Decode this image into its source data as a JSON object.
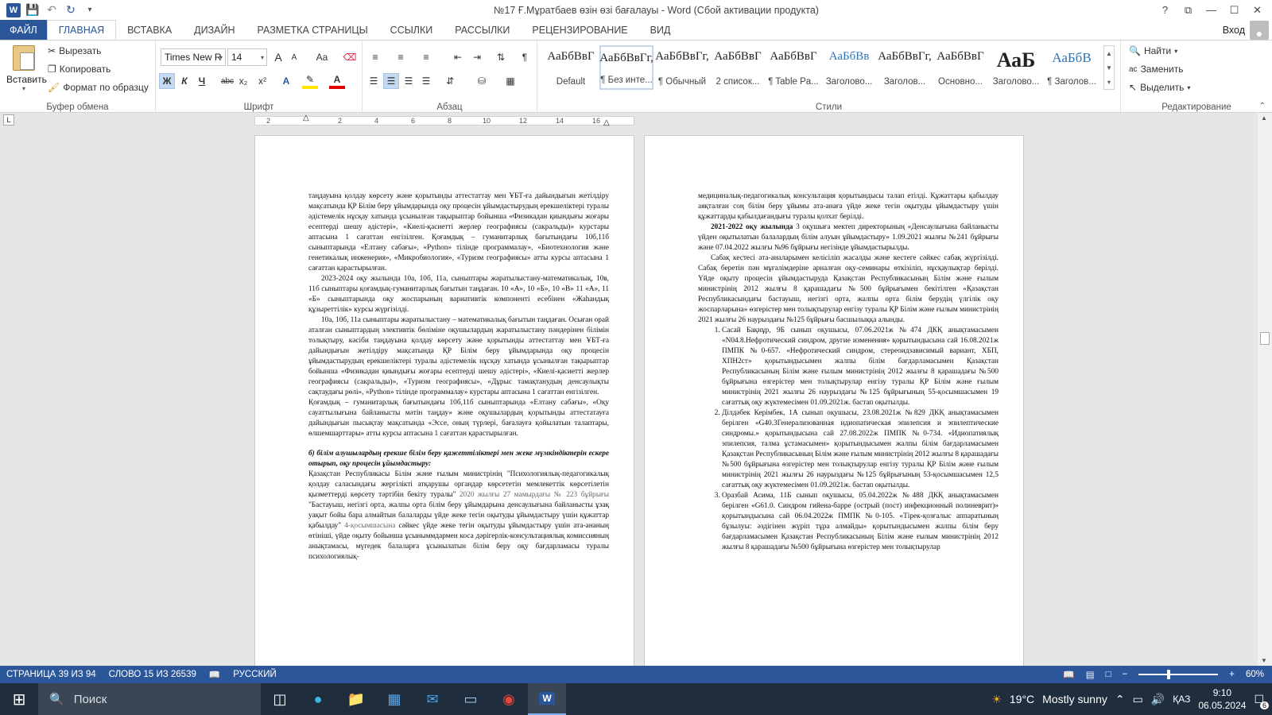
{
  "title": "№17 Ғ.Мұратбаев өзін өзі бағалауы - Word (Сбой активации продукта)",
  "window_controls": {
    "help": "?",
    "restore_ribbon": "⧉",
    "minimize": "—",
    "maximize": "☐",
    "close": "✕"
  },
  "tabs": [
    "ФАЙЛ",
    "ГЛАВНАЯ",
    "ВСТАВКА",
    "ДИЗАЙН",
    "РАЗМЕТКА СТРАНИЦЫ",
    "ССЫЛКИ",
    "РАССЫЛКИ",
    "РЕЦЕНЗИРОВАНИЕ",
    "ВИД"
  ],
  "signin": "Вход",
  "clipboard": {
    "paste": "Вставить",
    "cut": "Вырезать",
    "copy": "Копировать",
    "format_painter": "Формат по образцу",
    "group": "Буфер обмена"
  },
  "font": {
    "name": "Times New R",
    "size": "14",
    "group": "Шрифт",
    "bold": "Ж",
    "italic": "К",
    "underline": "Ч",
    "strike": "abc",
    "sub": "x₂",
    "sup": "x²",
    "grow": "A",
    "shrink": "A",
    "case": "Aa"
  },
  "paragraph": {
    "group": "Абзац"
  },
  "styles": {
    "group": "Стили",
    "items": [
      {
        "preview": "АаБбВвГ",
        "name": "Default"
      },
      {
        "preview": "АаБбВвГг,",
        "name": "¶ Без инте..."
      },
      {
        "preview": "АаБбВвГг,",
        "name": "¶ Обычный"
      },
      {
        "preview": "АаБбВвГ",
        "name": "2 список..."
      },
      {
        "preview": "АаБбВвГ",
        "name": "¶ Table Pa..."
      },
      {
        "preview": "АаБбВв",
        "name": "Заголово..."
      },
      {
        "preview": "АаБбВвГг,",
        "name": "Заголов..."
      },
      {
        "preview": "АаБбВвГ",
        "name": "Основно..."
      },
      {
        "preview": "АаБ",
        "name": "Заголово..."
      },
      {
        "preview": "АаБбВ",
        "name": "¶ Заголов..."
      }
    ]
  },
  "editing": {
    "find": "Найти",
    "replace": "Заменить",
    "select": "Выделить",
    "group": "Редактирование"
  },
  "ruler_labels": [
    "2",
    "2",
    "4",
    "6",
    "8",
    "10",
    "12",
    "14",
    "16"
  ],
  "page_left": {
    "p1": "таңдауына қолдау көрсету және қорытынды аттестаттау мен ҰБТ-ға дайындығын жетілдіру мақсатында ҚР Білім беру ұйымдарында оқу процесін ұйымдастырудың ерекшеліктері туралы әдістемелік нұсқау хатында ұсынылған тақырыптар бойынша «Физикадан қиындығы жоғары есептерді шешу әдістері», «Киелі-қасиетті жерлер географиясы (сакральды)» курстары аптасына 1 сағаттан енгізілген. Қоғамдық – гуманитарлық бағытындағы 10б,11б сыныптарында «Елтану сабағы», «Python» тілінде программалау», «Биотехнология және генетикалық инженерия», «Микробиология», «Туризм географиясы» атты курсы аптасына 1 сағаттан қарастырылған.",
    "p2": "2023-2024 оқу жылында 10а, 10б, 11а, сыныптары жаратылыстану-математикалық, 10в, 11б сыныптары қоғамдық-гуманитарлық бағытын таңдаған. 10 «А», 10 «Б», 10 «В» 11 «А», 11 «Б» сыныптарында оқу жоспарының вариативтік компоненті есебінен «Жаһандық құзыреттілік» курсы жүргізілді.",
    "p3": "10а, 10б, 11а сыныптары жаратылыстану – математикалық бағытын таңдаған. Осыған орай аталған сыныптардың элективтік бөліміне оқушылардың жаратылыстану пәндерінен білімін толықтыру, кәсіби таңдауына қолдау көрсету және қорытынды аттестаттау мен ҰБТ-ға дайындығын жетілдіру мақсатында ҚР Білім беру ұйымдарында оқу процесін ұйымдастырудың ерекшеліктері туралы әдістемелік нұсқау хатында ұсынылған тақырыптар бойынша «Физикадан қиындығы жоғары есептерді шешу әдістері», «Киелі-қасиетті жерлер географиясы (сакральды)», «Туризм географиясы», «Дұрыс тамақтанудың денсаулықты сақтаудағы рөлі», «Python» тілінде программалау» курстары аптасына 1 сағаттан енгізілген.",
    "p4": "Қоғамдық – гуманитарлық бағытындағы 10б,11б сыныптарында «Елтану сабағы», «Оқу сауаттылығына байланысты мәтін таңдау» және оқушылардың қорытынды аттестатауға дайындығын пысықтау мақсатында «Эссе, оның түрлері, бағалауға қойылатын талаптары, өлшемшарттары» атты курсы аптасына 1 сағаттан қарастырылған.",
    "heading": "б) білім алушылардың ерекше білім беру қажеттіліктері мен жеке мүмкіндіктерін ескере отырып, оқу процесін ұйымдастыру:",
    "p5a": "Қазақстан Республикасы Білім және ғылым министрінің \"Психологиялық-педагогикалық қолдау саласындағы жергілікті атқарушы органдар көрсететін мемлекеттік көрсетілетін қызметтерді көрсету тәртібін бекіту туралы\"",
    "p5b": " 2020 жылғы 27 мамырдағы № 223 бұйрығы ",
    "p5c": "\"Бастауыш, негізгі орта, жалпы орта білім беру ұйымдарына денсаулығына байланысты ұзақ уақыт бойы бара алмайтын балаларды үйде жеке тегін оқытуды ұйымдастыру үшін құжаттар қабылдау\"",
    "p5d": " 4-қосымшасына ",
    "p5e": "сәйкес үйде жеке тегін оқытуды ұйымдастыру үшін ата-ананың өтініші, үйде оқыту бойынша ұсыныммдармен коса дәрігерлік-консультациялық комиссияның анықтамасы, мүгедек балаларға ұсынылатын білім беру оқу бағдарламасы туралы психологиялық-"
  },
  "page_right": {
    "p1": "медициналық-педагогикалық консультация қорытындысы талап етілді. Құжаттары қабылдау аяқталған соң білім беру ұйымы ата-анаға үйде жеке тегін оқытуды ұйымдастыру үшін құжаттарды қабылдағандығы туралы қолхат берілді.",
    "p2a": "2021-2022 оқу жылында",
    "p2b": " 3 оқушыға мектеп директорының «Денсаулығына байланысты үйден оқытылатын балалардың білім алуын ұйымдастыру» 1.09.2021 жылғы №241 бұйрығы және 07.04.2022 жылғы №96 бұйрығы негізінде ұйымдастырылды.",
    "p3": "Сабақ кестесі ата-аналарымен келісіліп жасалды және кестеге сәйкес сабақ жүргізілді. Сабақ беретін пән мұғалімдеріне арналған оқу-семинары өткізіліп, нұсқаулықтар берілді. Үйде оқыту процесін ұйымдастыруда Қазақстан Республикасының Білім және ғылым министрінің 2012 жылғы 8 қарашадағы №500 бұйрығымен бекітілген «Қазақстан Республикасындағы бастауыш, негізгі орта, жалпы орта білім берудің үлгілік оқу жоспарларына» өзгерістер мен толықтырулар енгізу туралы ҚР Білім және ғылым министрінің 2021 жылғы 26 наурыздағы №125 бұйрығы басшылыққа алынды.",
    "li1": "Сасай Бақнұр, 9Б сынып оқушысы, 07.06.2021ж №474 ДКҚ анықтамасымен «N04.8.Нефротический синдром, другие изменения» қорытындысына сай 16.08.2021ж ПМПК №0-657. «Нефротический синдром, стереоидзависимый вариант, ХБП, ХПН2ст» қорытындысымен жалпы білім бағдарламасымен Қазақстан Республикасының Білім және ғылым министрінің 2012 жылғы 8 қарашадағы №500 бұйрығына өзгерістер мен толықтырулар енгізу туралы ҚР Білім және ғылым министрінің 2021 жылғы 26 наурыздағы №125 бұйрығының 55-қосымшасымен 19 сағаттық оқу жүктемесімен 01.09.2021ж. бастап оқытылды.",
    "li2": "Ділдәбек Керімбек, 1А сынып оқушысы, 23.08.2021ж №829 ДКҚ анықтамасымен берілген «G40.3Генерализованная идиопатическая эпилепсия и эпилептические синдромы.» қорытындысына сай 27.08.2022ж ПМПК №0-734. «Идиопатиялық эпилепсия, талма ұстамасымен» қорытындысымен жалпы білім бағдарламасымен Қазақстан Республикасының Білім және ғылым министрінің 2012 жылғы 8 қарашадағы №500 бұйрығына өзгерістер мен толықтырулар енгізу туралы ҚР Білім және ғылым министрінің 2021 жылғы 26 наурыздағы №125 бұйрығының 53-қосымшасымен 12,5 сағаттық оқу жүктемесімен 01.09.2021ж. бастап оқытылды.",
    "li3": "Оразбай Асима, 11Б сынып оқушысы, 05.04.2022ж №488 ДКҚ анықтамасымен берілген «G61.0. Синдром гийена-барре (острый (пост) инфекционный полиневрит)» қорытындысына сай 06.04.2022ж ПМПК №0-105. «Тірек-қозғалыс аппаратының бұзылуы: әздігінен жүріп тұра алмайды» қорытындысымен жалпы білім беру бағдарламасымен Қазақстан Республикасының Білім және ғылым министрінің 2012 жылғы 8 қарашадағы №500 бұйрығына өзгерістер мен толықтырулар"
  },
  "status": {
    "page": "СТРАНИЦА 39 ИЗ 94",
    "words": "СЛОВО 15 ИЗ 26539",
    "language": "РУССКИЙ",
    "zoom": "60%"
  },
  "taskbar": {
    "search": "Поиск",
    "weather_temp": "19°C",
    "weather_text": "Mostly sunny",
    "lang": "ҚАЗ",
    "time": "9:10",
    "date": "06.05.2024",
    "notif_count": "6"
  }
}
